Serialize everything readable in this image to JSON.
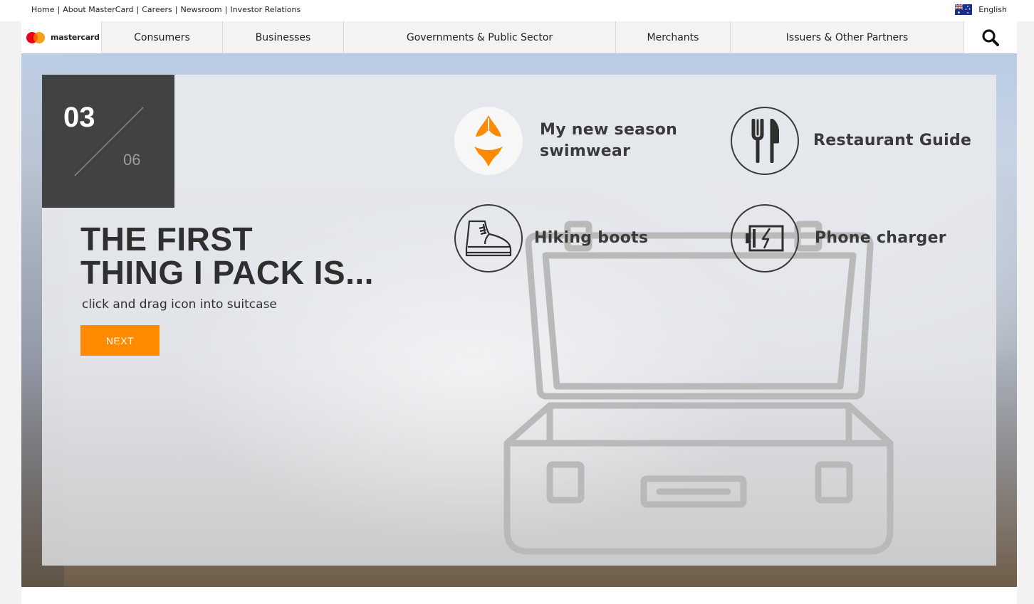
{
  "utility": {
    "links": [
      "Home",
      "About MasterCard",
      "Careers",
      "Newsroom",
      "Investor Relations"
    ],
    "separator": "|",
    "language": "English"
  },
  "logo": {
    "text": "mastercard"
  },
  "nav": {
    "items": [
      "Consumers",
      "Businesses",
      "Governments & Public Sector",
      "Merchants",
      "Issuers & Other Partners"
    ]
  },
  "hero": {
    "counter_current": "03",
    "counter_total": "06",
    "headline_line1": "THE FIRST",
    "headline_line2": "THING I PACK IS...",
    "subline": "click and drag icon into suitcase",
    "next_label": "NEXT"
  },
  "items": {
    "swimwear_line1": "My new season",
    "swimwear_line2": "swimwear",
    "restaurant": "Restaurant Guide",
    "boots": "Hiking boots",
    "charger": "Phone charger"
  },
  "colors": {
    "accent": "#ff8a00",
    "counter_bg": "#404244",
    "text_dark": "#2f2f2f"
  },
  "icons": [
    "flag-australia-icon",
    "mastercard-logo-icon",
    "search-icon",
    "bikini-icon",
    "fork-knife-icon",
    "boot-icon",
    "battery-charger-icon",
    "suitcase-icon"
  ]
}
